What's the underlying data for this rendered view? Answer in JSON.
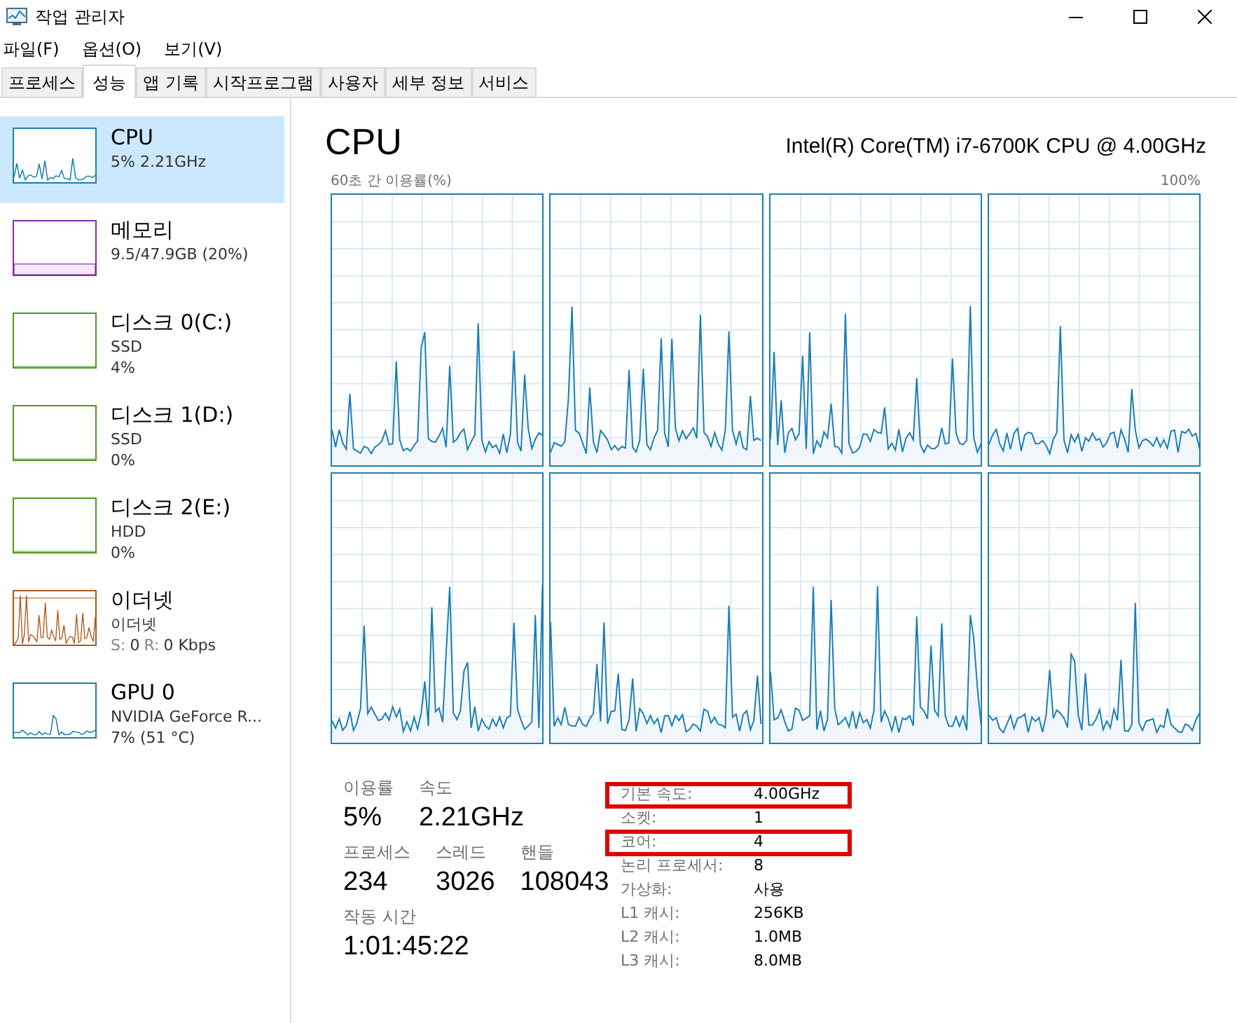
{
  "window": {
    "title": "작업 관리자"
  },
  "menu": [
    "파일(F)",
    "옵션(O)",
    "보기(V)"
  ],
  "tabs": [
    {
      "label": "프로세스",
      "selected": false
    },
    {
      "label": "성능",
      "selected": true
    },
    {
      "label": "앱 기록",
      "selected": false
    },
    {
      "label": "시작프로그램",
      "selected": false
    },
    {
      "label": "사용자",
      "selected": false
    },
    {
      "label": "세부 정보",
      "selected": false
    },
    {
      "label": "서비스",
      "selected": false
    }
  ],
  "sidebar": {
    "items": [
      {
        "title": "CPU",
        "lines": [
          "5% 2.21GHz"
        ],
        "selected": true,
        "color": "#1b7eb5",
        "kind": "line"
      },
      {
        "title": "메모리",
        "lines": [
          "9.5/47.9GB (20%)"
        ],
        "selected": false,
        "color": "#8b2aa5",
        "kind": "fill"
      },
      {
        "title": "디스크 0(C:)",
        "lines": [
          "SSD",
          "4%"
        ],
        "selected": false,
        "color": "#4e9a1e",
        "kind": "flat"
      },
      {
        "title": "디스크 1(D:)",
        "lines": [
          "SSD",
          "0%"
        ],
        "selected": false,
        "color": "#4e9a1e",
        "kind": "flat"
      },
      {
        "title": "디스크 2(E:)",
        "lines": [
          "HDD",
          "0%"
        ],
        "selected": false,
        "color": "#4e9a1e",
        "kind": "flat"
      },
      {
        "title": "이더넷",
        "lines": [
          "이더넷"
        ],
        "net": {
          "s_label": "S:",
          "s_value": "0",
          "r_label": "R:",
          "r_value": "0 Kbps"
        },
        "selected": false,
        "color": "#b3561a",
        "kind": "spiky"
      },
      {
        "title": "GPU 0",
        "lines": [
          "NVIDIA GeForce R...",
          "7% (51 °C)"
        ],
        "selected": false,
        "color": "#1b7eb5",
        "kind": "line"
      }
    ]
  },
  "main": {
    "title": "CPU",
    "model": "Intel(R) Core(TM) i7-6700K CPU @ 4.00GHz",
    "graph_caption": "60초 간 이용률(%)",
    "graph_max": "100%",
    "stats": [
      [
        {
          "label": "이용률",
          "value": "5%"
        },
        {
          "label": "속도",
          "value": "2.21GHz"
        }
      ],
      [
        {
          "label": "프로세스",
          "value": "234"
        },
        {
          "label": "스레드",
          "value": "3026"
        },
        {
          "label": "핸들",
          "value": "108043"
        }
      ],
      [
        {
          "label": "작동 시간",
          "value": "1:01:45:22"
        }
      ]
    ],
    "info": [
      {
        "label": "기본 속도:",
        "value": "4.00GHz",
        "highlighted": true
      },
      {
        "label": "소켓:",
        "value": "1",
        "highlighted": false
      },
      {
        "label": "코어:",
        "value": "4",
        "highlighted": true
      },
      {
        "label": "논리 프로세서:",
        "value": "8",
        "highlighted": false
      },
      {
        "label": "가상화:",
        "value": "사용",
        "highlighted": false
      },
      {
        "label": "L1 캐시:",
        "value": "256KB",
        "highlighted": false
      },
      {
        "label": "L2 캐시:",
        "value": "1.0MB",
        "highlighted": false
      },
      {
        "label": "L3 캐시:",
        "value": "8.0MB",
        "highlighted": false
      }
    ]
  }
}
